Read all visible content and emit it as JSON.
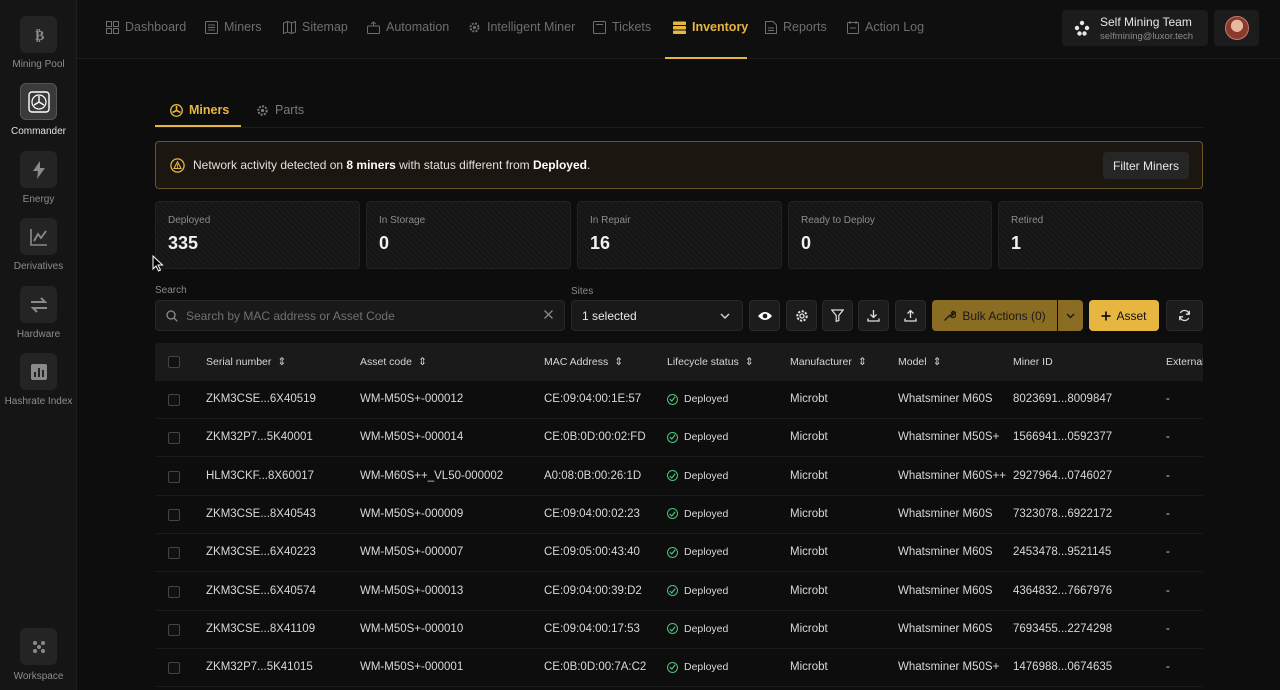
{
  "rail": {
    "items": [
      {
        "label": "Mining Pool",
        "icon": "bitcoin-icon"
      },
      {
        "label": "Commander",
        "icon": "fan-icon"
      },
      {
        "label": "Energy",
        "icon": "bolt-icon"
      },
      {
        "label": "Derivatives",
        "icon": "chart-icon"
      },
      {
        "label": "Hardware",
        "icon": "swap-icon"
      },
      {
        "label": "Hashrate Index",
        "icon": "bar-chart-icon"
      }
    ],
    "workspace": {
      "label": "Workspace",
      "icon": "workspace-icon"
    }
  },
  "topnav": {
    "items": [
      "Dashboard",
      "Miners",
      "Sitemap",
      "Automation",
      "Intelligent Miner",
      "Tickets",
      "Inventory",
      "Reports",
      "Action Log"
    ],
    "active": "Inventory",
    "account": {
      "name": "Self Mining Team",
      "email": "selfmining@luxor.tech"
    }
  },
  "subtabs": [
    "Miners",
    "Parts"
  ],
  "alert": {
    "prefix": "Network activity detected on",
    "count": "8 miners",
    "middle": "with status different from",
    "status": "Deployed",
    "suffix": ".",
    "button": "Filter Miners"
  },
  "stats": [
    {
      "label": "Deployed",
      "value": "335"
    },
    {
      "label": "In Storage",
      "value": "0"
    },
    {
      "label": "In Repair",
      "value": "16"
    },
    {
      "label": "Ready to Deploy",
      "value": "0"
    },
    {
      "label": "Retired",
      "value": "1"
    }
  ],
  "toolbar": {
    "search_label": "Search",
    "search_placeholder": "Search by MAC address or Asset Code",
    "sites_label": "Sites",
    "sites_value": "1 selected",
    "bulk_label": "Bulk Actions (0)",
    "asset_label": "Asset"
  },
  "table": {
    "columns": [
      "Serial number",
      "Asset code",
      "MAC Address",
      "Lifecycle status",
      "Manufacturer",
      "Model",
      "Miner ID",
      "External"
    ],
    "rows": [
      [
        "ZKM3CSE...6X40519",
        "WM-M50S+-000012",
        "CE:09:04:00:1E:57",
        "Deployed",
        "Microbt",
        "Whatsminer M60S",
        "8023691...8009847",
        "-"
      ],
      [
        "ZKM32P7...5K40001",
        "WM-M50S+-000014",
        "CE:0B:0D:00:02:FD",
        "Deployed",
        "Microbt",
        "Whatsminer M50S+",
        "1566941...0592377",
        "-"
      ],
      [
        "HLM3CKF...8X60017",
        "WM-M60S++_VL50-000002",
        "A0:08:0B:00:26:1D",
        "Deployed",
        "Microbt",
        "Whatsminer M60S++",
        "2927964...0746027",
        "-"
      ],
      [
        "ZKM3CSE...8X40543",
        "WM-M50S+-000009",
        "CE:09:04:00:02:23",
        "Deployed",
        "Microbt",
        "Whatsminer M60S",
        "7323078...6922172",
        "-"
      ],
      [
        "ZKM3CSE...6X40223",
        "WM-M50S+-000007",
        "CE:09:05:00:43:40",
        "Deployed",
        "Microbt",
        "Whatsminer M60S",
        "2453478...9521145",
        "-"
      ],
      [
        "ZKM3CSE...6X40574",
        "WM-M50S+-000013",
        "CE:09:04:00:39:D2",
        "Deployed",
        "Microbt",
        "Whatsminer M60S",
        "4364832...7667976",
        "-"
      ],
      [
        "ZKM3CSE...8X41109",
        "WM-M50S+-000010",
        "CE:09:04:00:17:53",
        "Deployed",
        "Microbt",
        "Whatsminer M60S",
        "7693455...2274298",
        "-"
      ],
      [
        "ZKM32P7...5K41015",
        "WM-M50S+-000001",
        "CE:0B:0D:00:7A:C2",
        "Deployed",
        "Microbt",
        "Whatsminer M50S+",
        "1476988...0674635",
        "-"
      ]
    ]
  },
  "colors": {
    "accent": "#e6b640",
    "status_ok": "#4cc37a",
    "background": "#0d0d0d"
  }
}
